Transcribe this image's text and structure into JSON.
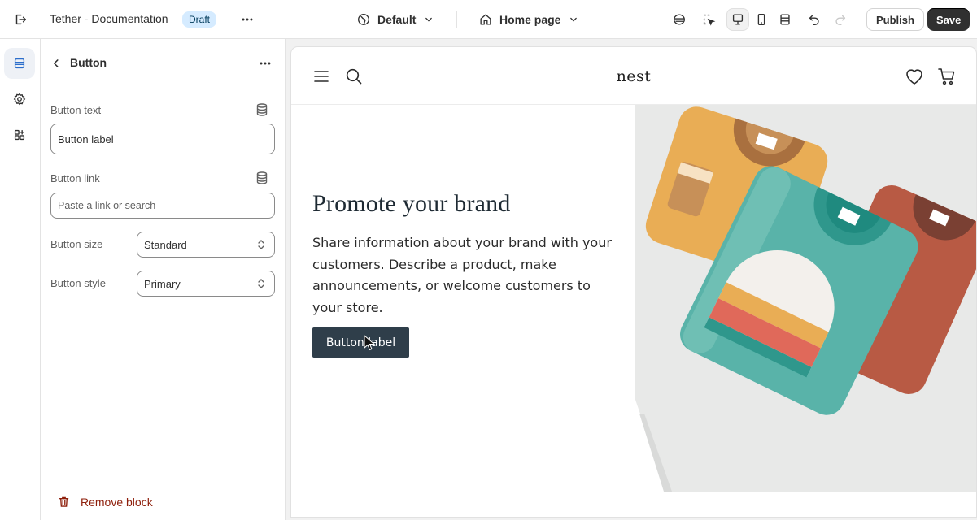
{
  "topbar": {
    "store_title": "Tether - Documentation",
    "status_badge": "Draft",
    "theme_selector": "Default",
    "page_selector": "Home page",
    "publish_label": "Publish",
    "save_label": "Save"
  },
  "rail": {
    "items": [
      "sections-icon",
      "settings-icon",
      "apps-icon"
    ]
  },
  "panel": {
    "title": "Button",
    "fields": {
      "button_text_label": "Button text",
      "button_text_value": "Button label",
      "button_link_label": "Button link",
      "button_link_placeholder": "Paste a link or search",
      "button_size_label": "Button size",
      "button_size_value": "Standard",
      "button_style_label": "Button style",
      "button_style_value": "Primary"
    },
    "remove_label": "Remove block"
  },
  "preview": {
    "store_logo": "nest",
    "hero_heading": "Promote your brand",
    "hero_body": "Share information about your brand with your customers. Describe a product, make announcements, or welcome customers to your store.",
    "hero_button": "Button label"
  },
  "colors": {
    "accent_dark": "#303030",
    "draft_badge_bg": "#d5ebff",
    "hero_button_bg": "#2f3e4a",
    "remove_text": "#8e1f0b"
  }
}
